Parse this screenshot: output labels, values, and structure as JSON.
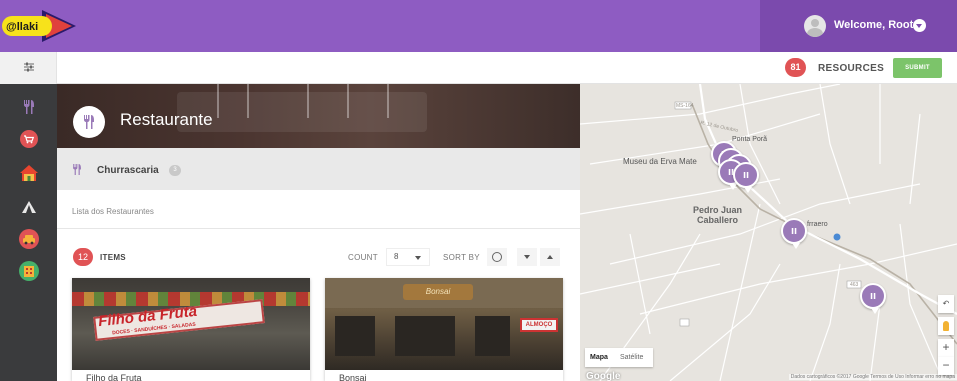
{
  "app": {
    "logo_text": "@llaki",
    "brand_color": "#8e5cc2",
    "brand_dark": "#7b4aad"
  },
  "user": {
    "welcome": "Welcome, Root"
  },
  "subbar": {
    "filter_icon": "sliders-icon",
    "resources_count": "81",
    "resources_label": "RESOURCES",
    "submit_label": "SUBMIT"
  },
  "sidebar": {
    "items": [
      {
        "icon": "fork-knife-icon"
      },
      {
        "icon": "shopping-cart-icon"
      },
      {
        "icon": "house-icon"
      },
      {
        "icon": "tent-icon"
      },
      {
        "icon": "car-icon"
      },
      {
        "icon": "hotel-icon"
      }
    ]
  },
  "hero": {
    "title": "Restaurante",
    "icon": "fork-knife-icon"
  },
  "category": {
    "label": "Churrascaria",
    "count": "3"
  },
  "description": "Lista dos Restaurantes",
  "list_controls": {
    "items_count": "12",
    "items_label": "ITEMS",
    "count_label": "COUNT",
    "count_value": "8",
    "sort_label": "SORT BY"
  },
  "cards": [
    {
      "sign": "Filho da Fruta",
      "sign_sub": "DOCES · SANDUÍCHES · SALADAS",
      "name": "Filho da Fruta"
    },
    {
      "sign": "Bonsai",
      "side_sign": "ALMOÇO",
      "name": "Bonsai"
    }
  ],
  "map": {
    "labels": {
      "street_top": "MS-164",
      "ponta_pora": "Ponta Porã",
      "museu": "Museu da Erva Mate",
      "pedro_juan": "Pedro Juan\nCaballero",
      "frraero": "frraero",
      "a463": "463",
      "r12": "R. 12 de Outubro"
    },
    "map_type": [
      "Mapa",
      "Satélite"
    ],
    "google": "Google",
    "attribution": "Dados cartográficos ©2017 Google  Termos de Uso  Informar erro no mapa",
    "pins": 7
  }
}
